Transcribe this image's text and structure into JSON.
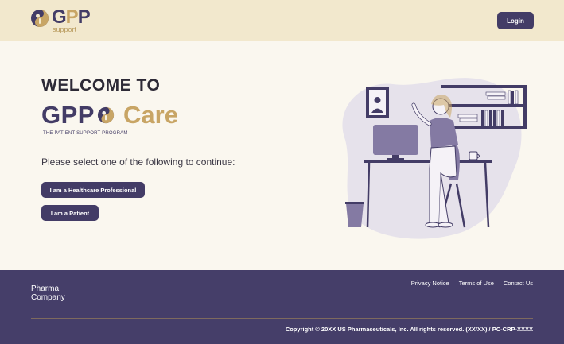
{
  "header": {
    "logo": {
      "brand_main": "G",
      "brand_gold": "P",
      "brand_end": "P",
      "sub": "support"
    },
    "login_label": "Login"
  },
  "hero": {
    "welcome": "WELCOME TO",
    "brand_gpp": "GPP",
    "brand_care": "Care",
    "tagline": "THE  PATIENT SUPPORT PROGRAM",
    "prompt": "Please select one of the following to continue:",
    "buttons": {
      "hcp": "I am a Healthcare Professional",
      "patient": "I am a Patient"
    }
  },
  "footer": {
    "company_line1": "Pharma",
    "company_line2": "Company",
    "links": [
      "Privacy Notice",
      "Terms of Use",
      "Contact Us"
    ],
    "copyright": "Copyright © 20XX US Pharmaceuticals, Inc. All rights reserved. (XX/XX) / PC-CRP-XXXX"
  },
  "colors": {
    "primary": "#433c66",
    "gold": "#c8a565",
    "header_bg": "#f2e8cd",
    "page_bg": "#faf7ef",
    "footer_bg": "#453e69"
  },
  "icons": [
    "gpp-logo-icon",
    "gpp-care-icon",
    "office-illustration"
  ]
}
